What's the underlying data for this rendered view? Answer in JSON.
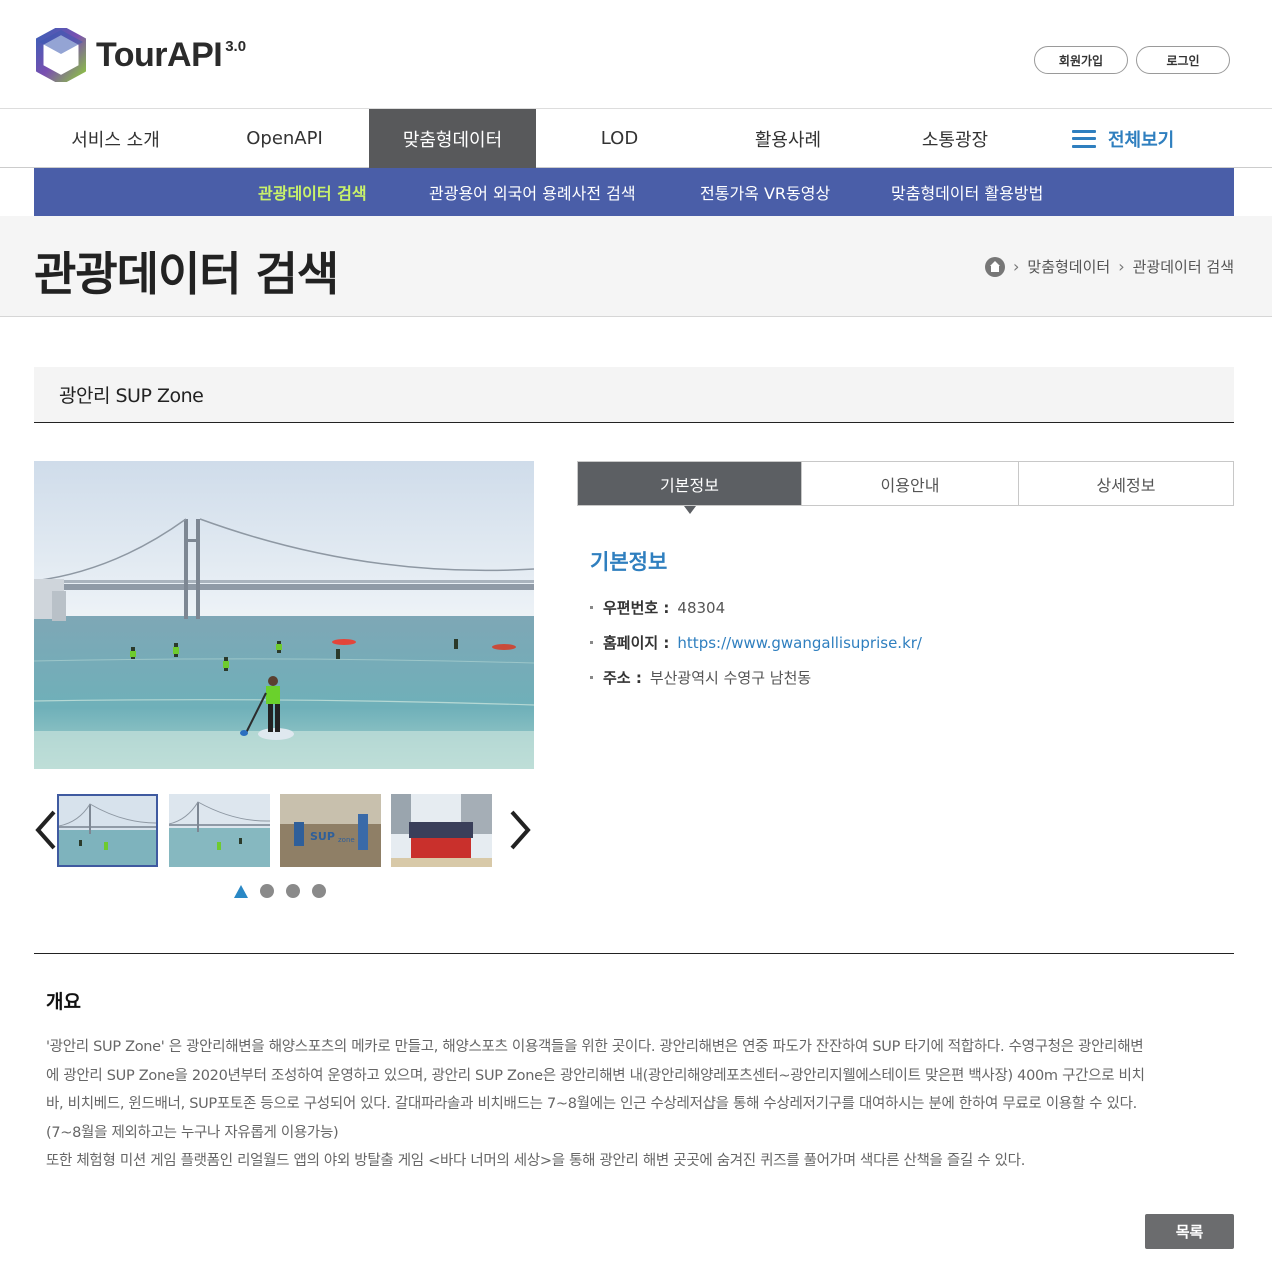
{
  "header": {
    "logo_text": "TourAPI",
    "logo_version": "3.0",
    "signup_label": "회원가입",
    "login_label": "로그인"
  },
  "gnb": {
    "items": [
      {
        "label": "서비스 소개"
      },
      {
        "label": "OpenAPI"
      },
      {
        "label": "맞춤형데이터",
        "active": true
      },
      {
        "label": "LOD"
      },
      {
        "label": "활용사례"
      },
      {
        "label": "소통광장"
      }
    ],
    "all_label": "전체보기",
    "accent_color": "#2f7fbf",
    "active_bg": "#58595b"
  },
  "subnav": {
    "items": [
      {
        "label": "관광데이터 검색",
        "active": true
      },
      {
        "label": "관광용어 외국어 용례사전 검색"
      },
      {
        "label": "전통가옥 VR동영상"
      },
      {
        "label": "맞춤형데이터 활용방법"
      }
    ],
    "bg_color": "#4a5ea8",
    "active_color": "#c9f26a"
  },
  "page": {
    "title": "관광데이터 검색",
    "breadcrumb": [
      "맞춤형데이터",
      "관광데이터 검색"
    ]
  },
  "item": {
    "title": "광안리 SUP Zone"
  },
  "gallery": {
    "thumbnail_count": 4,
    "selected_index": 0
  },
  "tabs": [
    {
      "label": "기본정보",
      "active": true
    },
    {
      "label": "이용안내"
    },
    {
      "label": "상세정보"
    }
  ],
  "info": {
    "heading": "기본정보",
    "rows": [
      {
        "key": "우편번호 :",
        "value": "48304"
      },
      {
        "key": "홈페이지 :",
        "value": "https://www.gwangallisuprise.kr/"
      },
      {
        "key": "주소 :",
        "value": "부산광역시 수영구 남천동"
      }
    ]
  },
  "overview": {
    "title": "개요",
    "lines": [
      "'광안리 SUP Zone' 은 광안리해변을 해양스포츠의 메카로 만들고, 해양스포츠 이용객들을 위한 곳이다. 광안리해변은 연중 파도가 잔잔하여 SUP 타기에 적합하다. 수영구청은 광안리해변",
      "에 광안리 SUP Zone을 2020년부터 조성하여 운영하고 있으며, 광안리 SUP Zone은 광안리해변 내(광안리해양레포츠센터~광안리지웰에스테이트 맞은편 백사장) 400m 구간으로 비치",
      "바, 비치베드, 윈드배너, SUP포토존 등으로 구성되어 있다. 갈대파라솔과 비치배드는 7~8월에는 인근 수상레저샵을 통해 수상레저기구를 대여하시는 분에 한하여 무료로 이용할 수 있다.",
      "(7~8월을 제외하고는 누구나 자유롭게 이용가능)",
      "또한 체험형 미션 게임 플랫폼인 리얼월드 앱의 야외 방탈출 게임 <바다 너머의 세상>을 통해 광안리 해변 곳곳에 숨겨진 퀴즈를 풀어가며 색다른 산책을 즐길 수 있다."
    ]
  },
  "footer": {
    "list_button": "목록"
  }
}
